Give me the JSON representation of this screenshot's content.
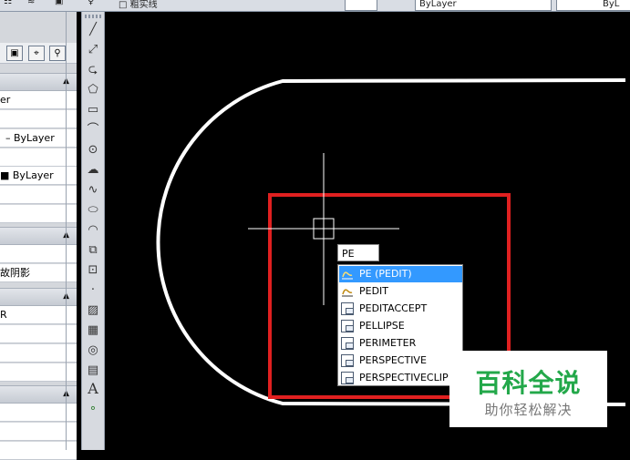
{
  "topbar": {
    "layer_name": "□ 粗实线",
    "linetype": "ByLayer",
    "lineweight": "ByL"
  },
  "properties": {
    "sections": [
      {
        "rows": [
          "er",
          "",
          "– ByLayer",
          "",
          "■ ByLayer",
          "",
          ""
        ]
      },
      {
        "rows": [
          "",
          "故阴影"
        ]
      },
      {
        "rows": [
          "R",
          "",
          "",
          "",
          ""
        ]
      },
      {
        "rows": [
          "",
          "",
          ""
        ]
      }
    ]
  },
  "draw_toolbar": {
    "items": [
      "line-icon",
      "construction-line-icon",
      "polyline-icon",
      "polygon-icon",
      "rectangle-icon",
      "arc-icon",
      "circle-icon",
      "revision-cloud-icon",
      "spline-icon",
      "ellipse-icon",
      "ellipse-arc-icon",
      "insert-block-icon",
      "make-block-icon",
      "point-icon",
      "hatch-icon",
      "gradient-icon",
      "region-icon",
      "table-icon",
      "multiline-text-icon",
      "add-selected-icon"
    ],
    "text_tool_label": "A"
  },
  "canvas": {
    "command_input": "PE",
    "colors": {
      "background": "#000000",
      "geometry": "#ffffff",
      "rectangle": "#e02020",
      "crosshair": "#ffffff"
    }
  },
  "autocomplete": {
    "selected_index": 0,
    "items": [
      {
        "label": "PE (PEDIT)",
        "icon": "pedit-icon"
      },
      {
        "label": "PEDIT",
        "icon": "pedit-icon"
      },
      {
        "label": "PEDITACCEPT",
        "icon": "command-icon"
      },
      {
        "label": "PELLIPSE",
        "icon": "command-icon"
      },
      {
        "label": "PERIMETER",
        "icon": "command-icon"
      },
      {
        "label": "PERSPECTIVE",
        "icon": "command-icon"
      },
      {
        "label": "PERSPECTIVECLIP",
        "icon": "command-icon"
      }
    ]
  },
  "watermark": {
    "title": "百科全说",
    "subtitle": "助你轻松解决"
  }
}
